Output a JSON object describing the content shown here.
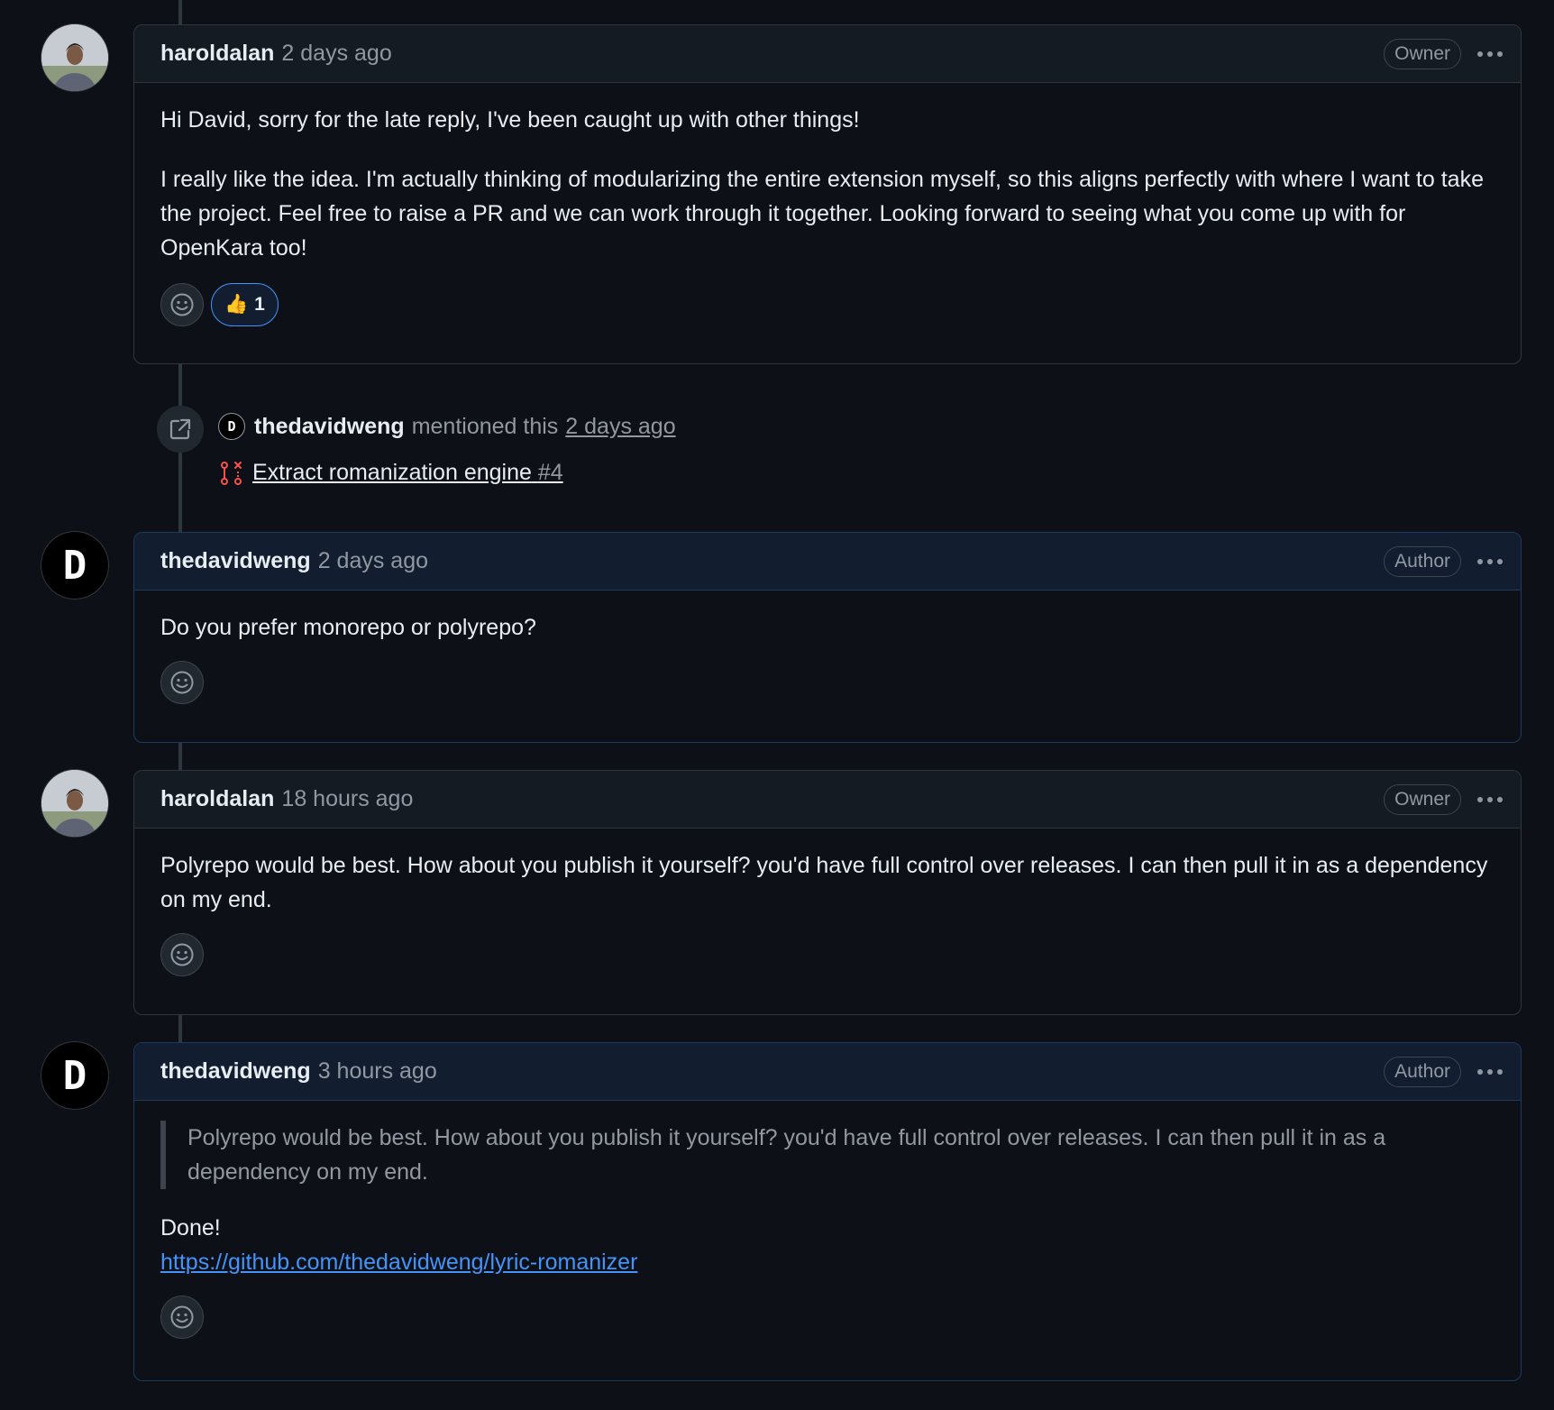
{
  "comments": [
    {
      "user": "haroldalan",
      "time": "2 days ago",
      "role": "Owner",
      "paragraphs": [
        "Hi David, sorry for the late reply, I've been caught up with other things!",
        "I really like the idea. I'm actually thinking of modularizing the entire extension myself, so this aligns perfectly with where I want to take the project. Feel free to raise a PR and we can work through it together. Looking forward to seeing what you come up with for OpenKara too!"
      ],
      "reaction": {
        "icon": "thumbs-up",
        "emoji": "👍",
        "count": "1"
      }
    },
    {
      "user": "thedavidweng",
      "time": "2 days ago",
      "role": "Author",
      "paragraphs": [
        "Do you prefer monorepo or polyrepo?"
      ]
    },
    {
      "user": "haroldalan",
      "time": "18 hours ago",
      "role": "Owner",
      "paragraphs": [
        "Polyrepo would be best. How about you publish it yourself? you'd have full control over releases. I can then pull it in as a dependency on my end."
      ]
    },
    {
      "user": "thedavidweng",
      "time": "3 hours ago",
      "role": "Author",
      "quote": "Polyrepo would be best. How about you publish it yourself? you'd have full control over releases. I can then pull it in as a dependency on my end.",
      "text": "Done!",
      "link": "https://github.com/thedavidweng/lyric-romanizer"
    }
  ],
  "mention_event": {
    "avatar_letter": "D",
    "user": "thedavidweng",
    "action": "mentioned this",
    "time": "2 days ago",
    "pr_title": "Extract romanization engine",
    "pr_number": "#4",
    "pr_icon": "git-pull-request-closed-icon"
  },
  "avatar_letter": "D",
  "colors": {
    "background": "#0d1117",
    "link": "#4493f8",
    "pr_closed": "#f85149"
  }
}
